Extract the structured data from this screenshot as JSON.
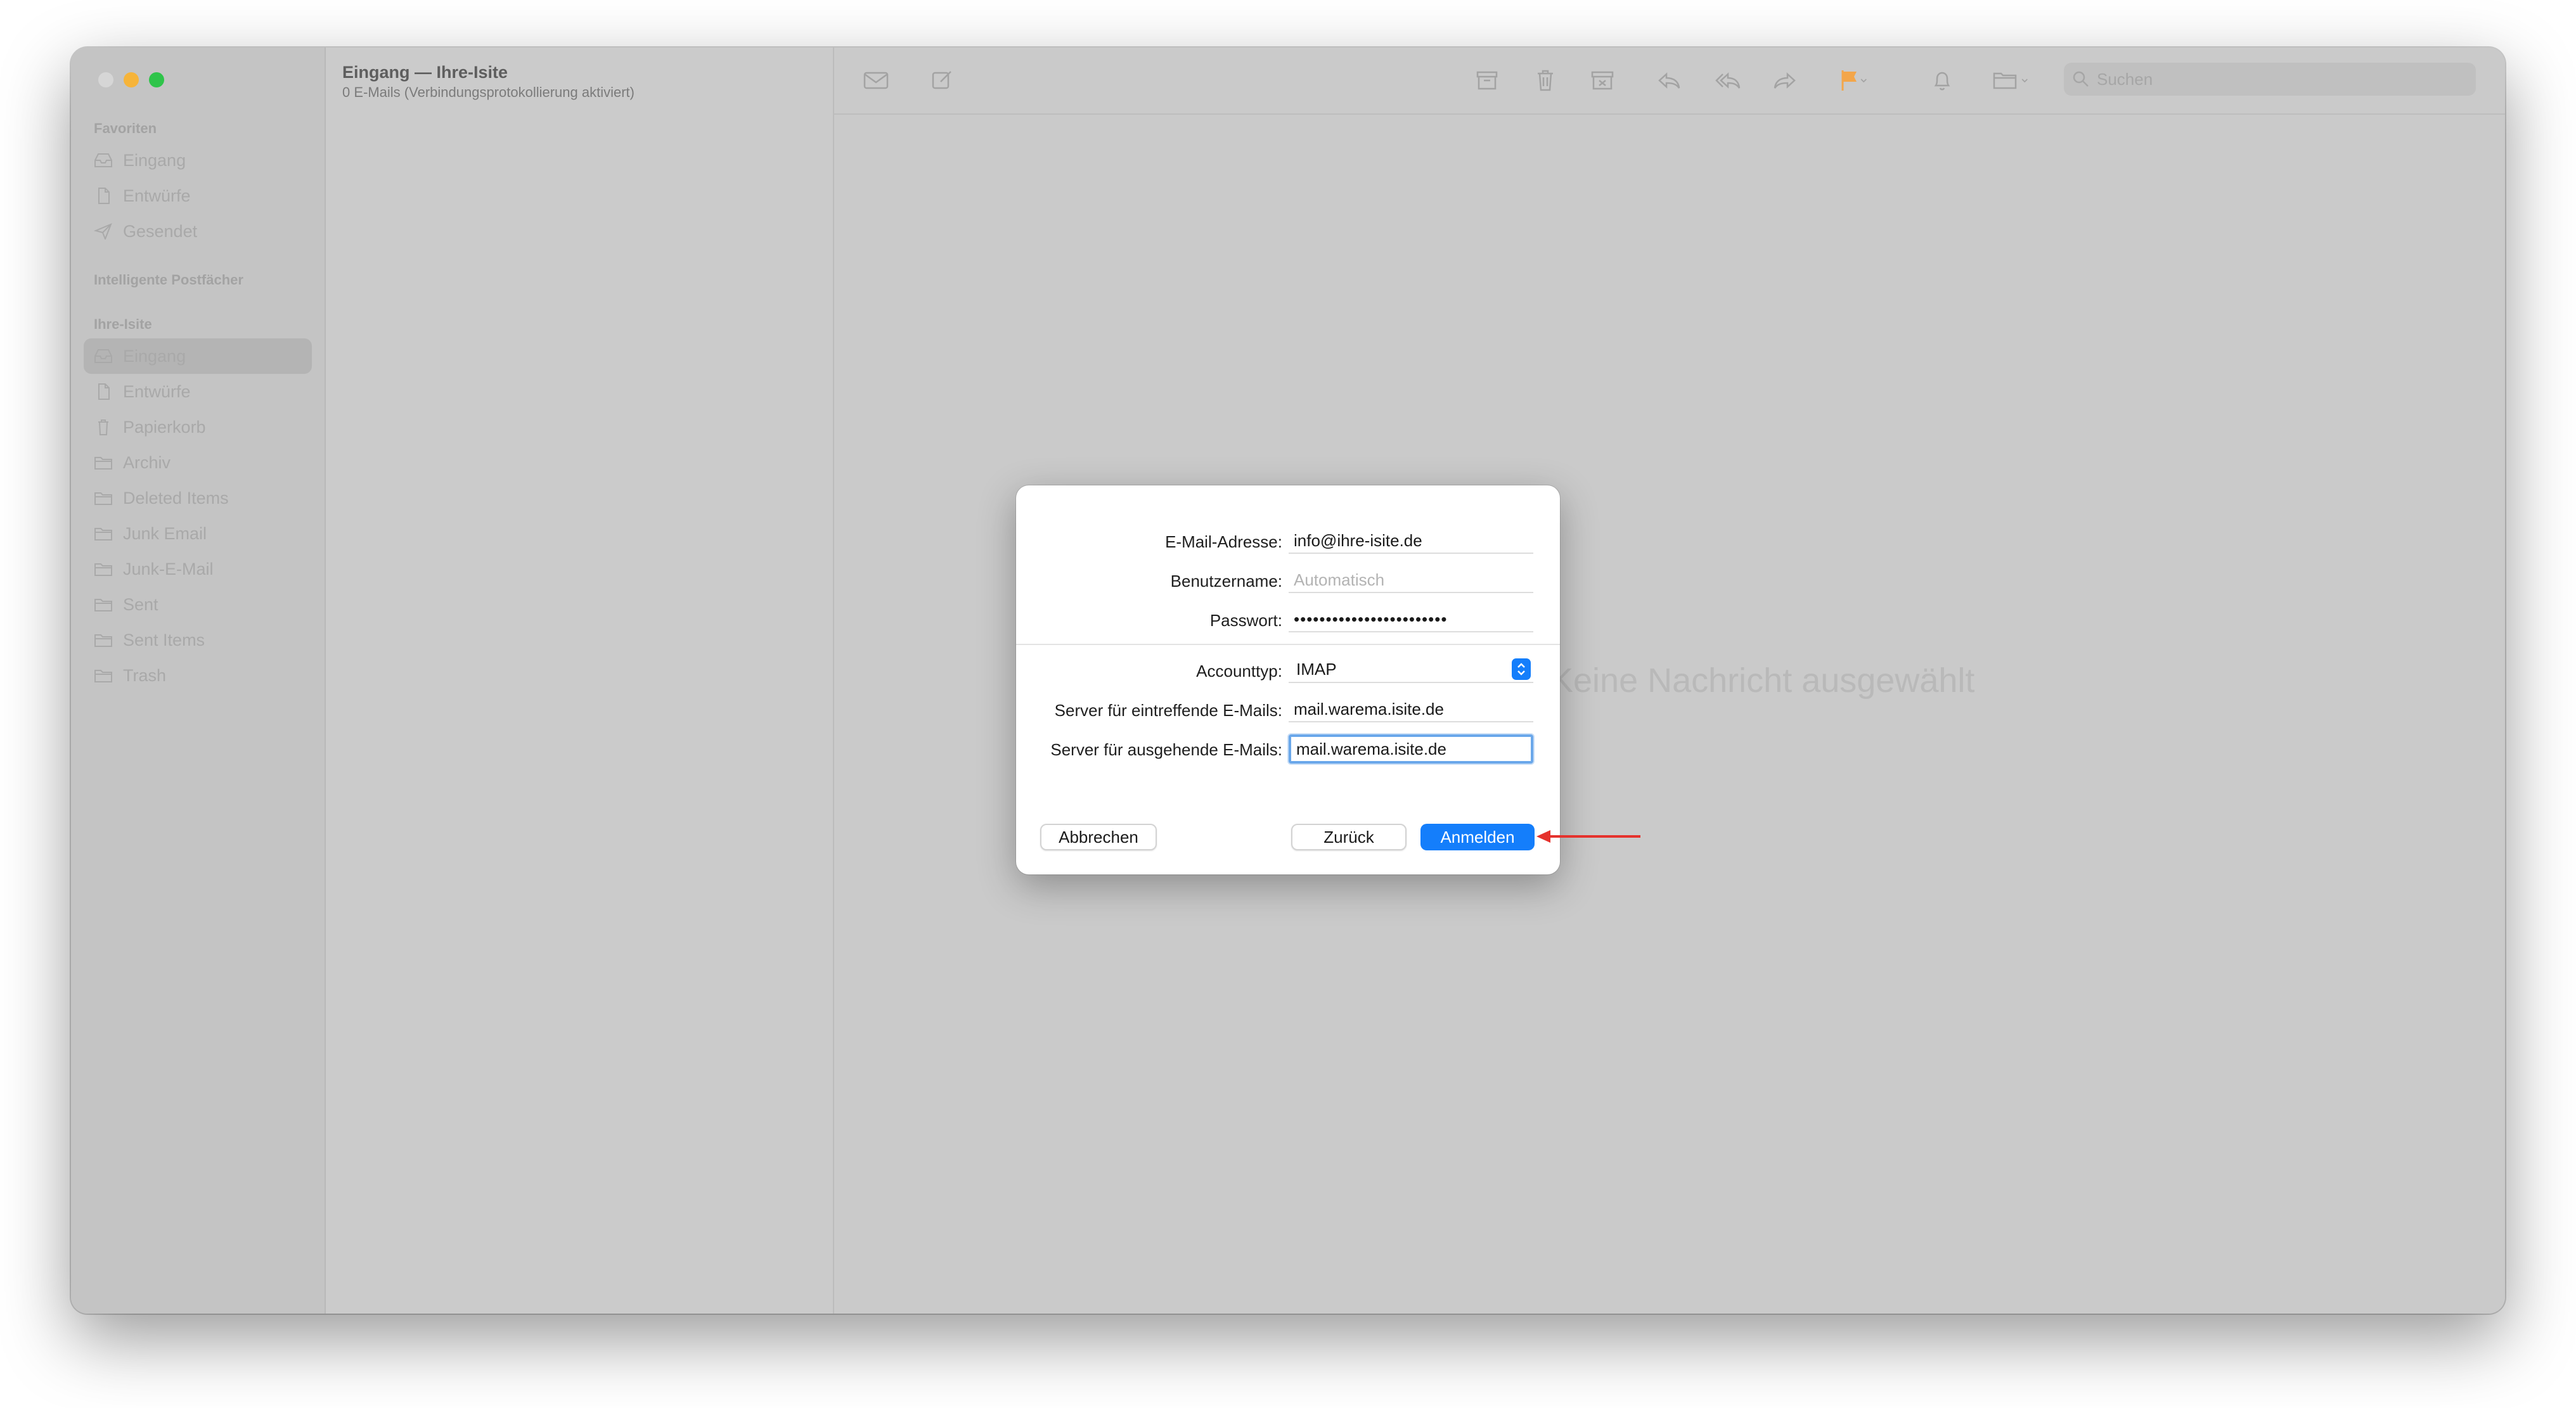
{
  "sidebar": {
    "sections": {
      "favorites": "Favoriten",
      "smart": "Intelligente Postfächer",
      "account": "Ihre-Isite"
    },
    "favorites": [
      {
        "label": "Eingang",
        "icon": "tray-icon"
      },
      {
        "label": "Entwürfe",
        "icon": "document-icon"
      },
      {
        "label": "Gesendet",
        "icon": "paperplane-icon"
      }
    ],
    "account_items": [
      {
        "label": "Eingang",
        "icon": "tray-icon",
        "selected": true
      },
      {
        "label": "Entwürfe",
        "icon": "document-icon"
      },
      {
        "label": "Papierkorb",
        "icon": "trash-icon"
      },
      {
        "label": "Archiv",
        "icon": "folder-icon"
      },
      {
        "label": "Deleted Items",
        "icon": "folder-icon"
      },
      {
        "label": "Junk Email",
        "icon": "folder-icon"
      },
      {
        "label": "Junk-E-Mail",
        "icon": "folder-icon"
      },
      {
        "label": "Sent",
        "icon": "folder-icon"
      },
      {
        "label": "Sent Items",
        "icon": "folder-icon"
      },
      {
        "label": "Trash",
        "icon": "folder-icon"
      }
    ]
  },
  "message_list": {
    "title": "Eingang — Ihre-Isite",
    "subtitle": "0 E-Mails (Verbindungsprotokollierung aktiviert)"
  },
  "toolbar": {
    "search_placeholder": "Suchen"
  },
  "content": {
    "empty_text": "Keine Nachricht ausgewählt"
  },
  "dialog": {
    "email_label": "E-Mail-Adresse:",
    "email_value": "info@ihre-isite.de",
    "username_label": "Benutzername:",
    "username_placeholder": "Automatisch",
    "password_label": "Passwort:",
    "password_value": "••••••••••••••••••••••••",
    "account_type_label": "Accounttyp:",
    "account_type_value": "IMAP",
    "incoming_label": "Server für eintreffende E-Mails:",
    "incoming_value": "mail.warema.isite.de",
    "outgoing_label": "Server für ausgehende E-Mails:",
    "outgoing_value": "mail.warema.isite.de",
    "cancel_button": "Abbrechen",
    "back_button": "Zurück",
    "signin_button": "Anmelden"
  },
  "colors": {
    "accent": "#147efb",
    "annotation_arrow": "#e5322d",
    "close_light": "#d2d2d2",
    "minimize_light": "#f6b43a",
    "zoom_light": "#2fc44a",
    "flag": "#f3a64a"
  }
}
